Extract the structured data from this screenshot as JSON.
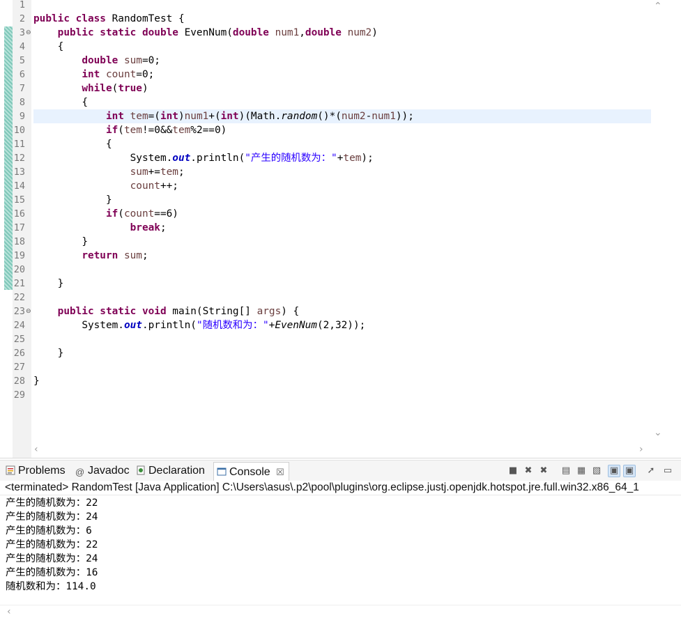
{
  "editor": {
    "line_numbers": [
      "1",
      "2",
      "3",
      "4",
      "5",
      "6",
      "7",
      "8",
      "9",
      "10",
      "11",
      "12",
      "13",
      "14",
      "15",
      "16",
      "17",
      "18",
      "19",
      "20",
      "21",
      "22",
      "23",
      "24",
      "25",
      "26",
      "27",
      "28",
      "29"
    ],
    "fold_marker": "⊖",
    "code": {
      "l2": [
        "public class ",
        "RandomTest {"
      ],
      "l3": [
        "public static double ",
        "EvenNum(",
        "double ",
        "num1",
        ",",
        "double ",
        "num2",
        ")"
      ],
      "l4": "{",
      "l5": [
        "double ",
        "sum",
        "=0;"
      ],
      "l6": [
        "int ",
        "count",
        "=0;"
      ],
      "l7": [
        "while",
        "(",
        "true",
        ")"
      ],
      "l8": "{",
      "l9": [
        "int ",
        "tem",
        "=(",
        "int",
        ")",
        "num1",
        "+(",
        "int",
        ")(Math.",
        "random",
        "()*(",
        "num2",
        "-",
        "num1",
        "));"
      ],
      "l10": [
        "if",
        "(",
        "tem",
        "!=0&&",
        "tem",
        "%2==0)"
      ],
      "l11": "{",
      "l12": [
        "System.",
        "out",
        ".println(",
        "\"产生的随机数为：\"",
        "+",
        "tem",
        ");"
      ],
      "l13": [
        "sum",
        "+=",
        "tem",
        ";"
      ],
      "l14": [
        "count",
        "++;"
      ],
      "l15": "}",
      "l16": [
        "if",
        "(",
        "count",
        "==6)"
      ],
      "l17": [
        "break",
        ";"
      ],
      "l18": "}",
      "l19": [
        "return ",
        "sum",
        ";"
      ],
      "l21": "}",
      "l23": [
        "public static void ",
        "main(String[] ",
        "args",
        ") {"
      ],
      "l24": [
        "System.",
        "out",
        ".println(",
        "\"随机数和为：\"",
        "+",
        "EvenNum",
        "(2,32));"
      ],
      "l26": "}",
      "l28": "}"
    }
  },
  "panel": {
    "tabs": [
      {
        "label": "Problems",
        "icon": "problems-icon"
      },
      {
        "label": "Javadoc",
        "icon": "javadoc-icon"
      },
      {
        "label": "Declaration",
        "icon": "declaration-icon"
      },
      {
        "label": "Console",
        "icon": "console-icon",
        "close": "☒",
        "active": true
      }
    ]
  },
  "console": {
    "header": "<terminated> RandomTest [Java Application] C:\\Users\\asus\\.p2\\pool\\plugins\\org.eclipse.justj.openjdk.hotspot.jre.full.win32.x86_64_1",
    "output": [
      "产生的随机数为：22",
      "产生的随机数为：24",
      "产生的随机数为：6",
      "产生的随机数为：22",
      "产生的随机数为：24",
      "产生的随机数为：16",
      "随机数和为：114.0"
    ]
  },
  "colors": {
    "keyword": "#7f0055",
    "string": "#2a00ff",
    "field": "#0000c0",
    "local_variable": "#6a3e3e",
    "current_line": "#e8f2fe"
  }
}
